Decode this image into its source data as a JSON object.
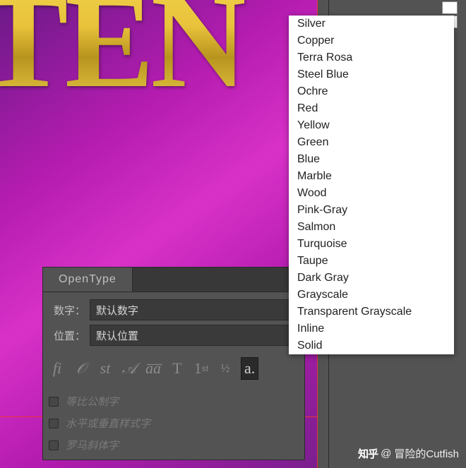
{
  "canvas": {
    "big_text": "TEN"
  },
  "panel": {
    "tab": "OpenType",
    "rows": {
      "figures": {
        "label": "数字：",
        "value": "默认数字"
      },
      "position": {
        "label": "位置：",
        "value": "默认位置"
      }
    },
    "icons": {
      "ligatures": "fi",
      "swash": "𝒪",
      "stylistic": "st",
      "titling": "𝒜",
      "contextual": "a̅a̅",
      "allcaps": "T",
      "ordinals": "1ˢᵗ",
      "fractions": "½",
      "stylesets": "a"
    },
    "checks": {
      "proportional": "等比公制字",
      "hv_style": "水平或垂直样式字",
      "roman_italic": "罗马斜体字"
    }
  },
  "dropdown": {
    "items": [
      "Silver",
      "Copper",
      "Terra Rosa",
      "Steel Blue",
      "Ochre",
      "Red",
      "Yellow",
      "Green",
      "Blue",
      "Marble",
      "Wood",
      "Pink-Gray",
      "Salmon",
      "Turquoise",
      "Taupe",
      "Dark Gray",
      "Grayscale",
      "Transparent Grayscale",
      "Inline",
      "Solid"
    ]
  },
  "watermark": {
    "brand": "知乎",
    "prefix": "@",
    "name": "冒险的Cutfish"
  }
}
